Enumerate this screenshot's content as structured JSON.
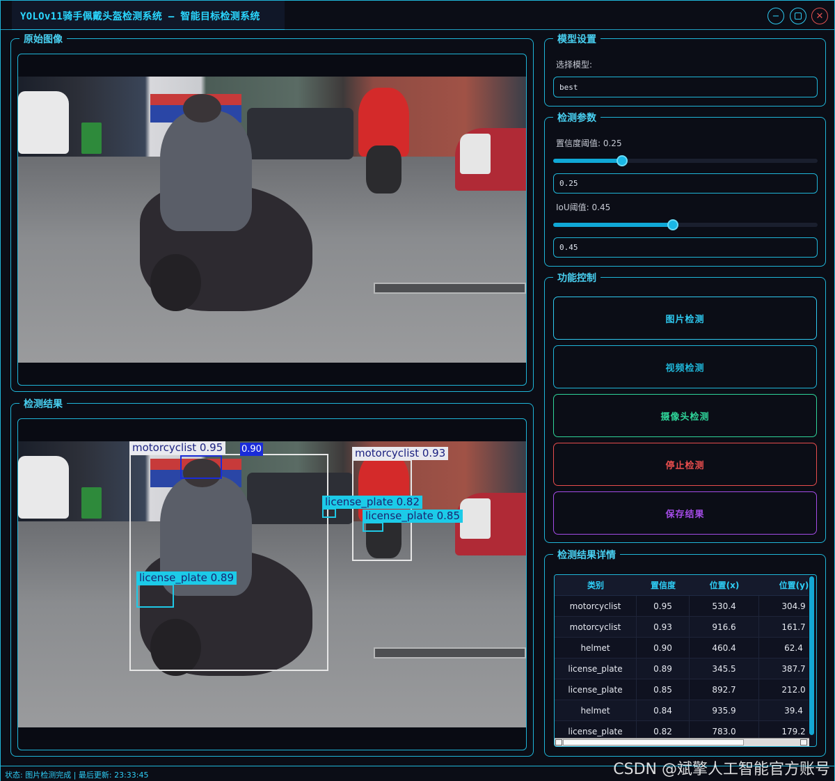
{
  "window": {
    "title": "YOLOv11骑手佩戴头盔检测系统 – 智能目标检测系统",
    "controls": {
      "minimize_icon": "minimize-icon",
      "maximize_icon": "maximize-icon",
      "close_icon": "close-icon"
    }
  },
  "panels": {
    "original_title": "原始图像",
    "result_title": "检测结果",
    "model_title": "模型设置",
    "params_title": "检测参数",
    "func_title": "功能控制",
    "details_title": "检测结果详情"
  },
  "model": {
    "select_label": "选择模型:",
    "selected": "best"
  },
  "params": {
    "conf_label": "置信度阈值: 0.25",
    "conf_value": "0.25",
    "conf_fraction": 0.25,
    "iou_label": "IoU阈值: 0.45",
    "iou_value": "0.45",
    "iou_fraction": 0.45
  },
  "buttons": {
    "image_detect": "图片检测",
    "video_detect": "视频检测",
    "camera_detect": "摄像头检测",
    "stop_detect": "停止检测",
    "save_result": "保存结果"
  },
  "colors": {
    "accent": "#1fb6d9",
    "image_btn": "#2ec9f0",
    "video_btn": "#1fb6d9",
    "camera_btn": "#2fd59a",
    "stop_btn": "#e84d4d",
    "save_btn": "#a54ce8"
  },
  "detections": {
    "moto1": "motorcyclist  0.95",
    "helmet1": "0.90",
    "moto2": "motorcyclist  0.93",
    "plate1": "license_plate  0.89",
    "plate2": "license_plate  0.85",
    "plate3": "license_plate  0.82"
  },
  "table": {
    "headers": [
      "类别",
      "置信度",
      "位置(x)",
      "位置(y)"
    ],
    "rows": [
      [
        "motorcyclist",
        "0.95",
        "530.4",
        "304.9"
      ],
      [
        "motorcyclist",
        "0.93",
        "916.6",
        "161.7"
      ],
      [
        "helmet",
        "0.90",
        "460.4",
        "62.4"
      ],
      [
        "license_plate",
        "0.89",
        "345.5",
        "387.7"
      ],
      [
        "license_plate",
        "0.85",
        "892.7",
        "212.0"
      ],
      [
        "helmet",
        "0.84",
        "935.9",
        "39.4"
      ],
      [
        "license_plate",
        "0.82",
        "783.0",
        "179.2"
      ]
    ]
  },
  "status": {
    "text": "状态: 图片检测完成 | 最后更新: 23:33:45"
  },
  "watermark": "CSDN @斌擎人工智能官方账号"
}
